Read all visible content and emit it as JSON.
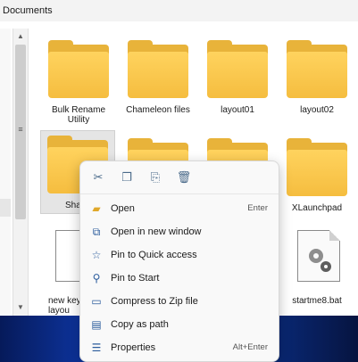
{
  "window": {
    "title": "Documents"
  },
  "files": [
    {
      "name": "Bulk Rename Utility",
      "line1": "Bulk Rename",
      "line2": "Utility",
      "type": "folder"
    },
    {
      "name": "Chameleon files",
      "type": "folder"
    },
    {
      "name": "layout01",
      "type": "folder"
    },
    {
      "name": "layout02",
      "type": "folder"
    },
    {
      "name": "Sha",
      "type": "folder",
      "selected": true
    },
    {
      "name": "XLaunchpad",
      "type": "folder"
    },
    {
      "name": "new key layou",
      "line1": "new key",
      "line2": "layou",
      "type": "file"
    },
    {
      "name": "startme8.bat",
      "type": "bat"
    }
  ],
  "context_menu": {
    "toolbar": [
      {
        "icon": "cut-icon",
        "glyph": "✂"
      },
      {
        "icon": "copy-icon",
        "glyph": "❐"
      },
      {
        "icon": "rename-icon",
        "glyph": "⎘"
      },
      {
        "icon": "delete-icon",
        "glyph": "🗑"
      }
    ],
    "items": [
      {
        "label": "Open",
        "shortcut": "Enter",
        "icon": "folder-open-icon",
        "glyph": "▰"
      },
      {
        "label": "Open in new window",
        "shortcut": "",
        "icon": "new-window-icon",
        "glyph": "⧉"
      },
      {
        "label": "Pin to Quick access",
        "shortcut": "",
        "icon": "star-icon",
        "glyph": "☆"
      },
      {
        "label": "Pin to Start",
        "shortcut": "",
        "icon": "pin-icon",
        "glyph": "⚲"
      },
      {
        "label": "Compress to Zip file",
        "shortcut": "",
        "icon": "zip-icon",
        "glyph": "▭"
      },
      {
        "label": "Copy as path",
        "shortcut": "",
        "icon": "copy-path-icon",
        "glyph": "▤"
      },
      {
        "label": "Properties",
        "shortcut": "Alt+Enter",
        "icon": "properties-icon",
        "glyph": "☰"
      }
    ]
  },
  "colors": {
    "folder": "#f5bd3f",
    "menu_bg": "#f9f9f9",
    "accent": "#2a5b9c"
  }
}
